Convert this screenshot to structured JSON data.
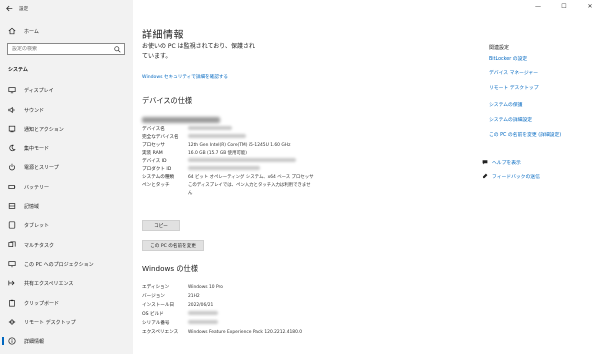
{
  "window": {
    "app_title": "設定",
    "controls": [
      "—",
      "☐",
      "✕"
    ]
  },
  "sidebar": {
    "search_placeholder": "設定の検索",
    "section_label": "システム",
    "items": [
      {
        "label": "ホーム",
        "icon": "home-icon"
      },
      {
        "label": "ディスプレイ",
        "icon": "display-icon"
      },
      {
        "label": "サウンド",
        "icon": "sound-icon"
      },
      {
        "label": "通知とアクション",
        "icon": "notification-icon"
      },
      {
        "label": "集中モード",
        "icon": "focus-moon-icon"
      },
      {
        "label": "電源とスリープ",
        "icon": "power-icon"
      },
      {
        "label": "バッテリー",
        "icon": "battery-icon"
      },
      {
        "label": "記憶域",
        "icon": "storage-icon"
      },
      {
        "label": "タブレット",
        "icon": "tablet-icon"
      },
      {
        "label": "マルチタスク",
        "icon": "multitask-icon"
      },
      {
        "label": "この PC へのプロジェクション",
        "icon": "projection-icon"
      },
      {
        "label": "共有エクスペリエンス",
        "icon": "shared-icon"
      },
      {
        "label": "クリップボード",
        "icon": "clipboard-icon"
      },
      {
        "label": "リモート デスクトップ",
        "icon": "remote-desktop-icon"
      },
      {
        "label": "詳細情報",
        "icon": "info-icon"
      }
    ]
  },
  "main": {
    "title": "詳細情報",
    "status_line1": "お使いの PC は監視されており、保護され",
    "status_line2": "ています。",
    "security_link": "Windows セキュリティで詳細を確認する",
    "device_spec_heading": "デバイスの仕様",
    "device_specs": [
      {
        "key": "デバイス名",
        "value": ""
      },
      {
        "key": "完全なデバイス名",
        "value": ""
      },
      {
        "key": "プロセッサ",
        "value": "12th Gen Intel(R) Core(TM) i5-1245U   1.60 GHz"
      },
      {
        "key": "実装 RAM",
        "value": "16.0 GB (15.7 GB 使用可能)"
      },
      {
        "key": "デバイス ID",
        "value": ""
      },
      {
        "key": "プロダクト ID",
        "value": ""
      },
      {
        "key": "システムの種類",
        "value": "64 ビット オペレーティング システム、x64 ベース プロセッサ"
      },
      {
        "key": "ペンとタッチ",
        "value": "このディスプレイでは、ペン入力とタッチ入力は利用できませ"
      },
      {
        "key": "",
        "value": "ん"
      }
    ],
    "copy_button": "コピー",
    "rename_button": "この PC の名前を変更",
    "windows_spec_heading": "Windows の仕様",
    "windows_specs": [
      {
        "key": "エディション",
        "value": "Windows 10 Pro"
      },
      {
        "key": "バージョン",
        "value": "21H2"
      },
      {
        "key": "インストール日",
        "value": "2022/06/21"
      },
      {
        "key": "OS ビルド",
        "value": ""
      },
      {
        "key": "シリアル番号",
        "value": ""
      },
      {
        "key": "エクスペリエンス",
        "value": "Windows Feature Experience Pack 120.2212.4180.0"
      }
    ]
  },
  "related": {
    "heading": "関連設定",
    "links": [
      "BitLocker の設定",
      "デバイス マネージャー",
      "リモート デスクトップ",
      "システムの保護",
      "システムの詳細設定",
      "この PC の名前を変更 (詳細設定)"
    ],
    "help": "ヘルプを表示",
    "feedback": "フィードバックの送信"
  },
  "colors": {
    "accent": "#0067c0",
    "sidebar_bg": "#f2f2f2",
    "button_bg": "#e1e1e1"
  }
}
